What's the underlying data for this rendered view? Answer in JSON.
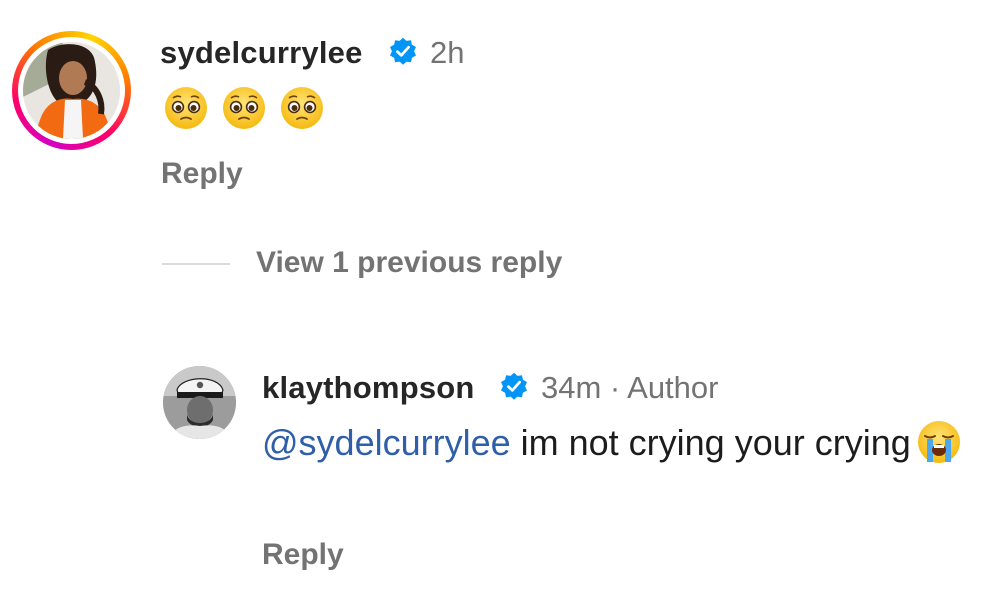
{
  "comments": [
    {
      "username": "sydelcurrylee",
      "verified": true,
      "time": "2h",
      "emojis": [
        "pleading-face",
        "pleading-face",
        "pleading-face"
      ],
      "reply_label": "Reply"
    }
  ],
  "replies_toggle": {
    "label": "View 1 previous reply"
  },
  "reply": {
    "username": "klaythompson",
    "verified": true,
    "meta": "34m · Author",
    "mention": "@sydelcurrylee",
    "text": " im not crying your crying",
    "emoji": "loudly-crying-face",
    "reply_label": "Reply"
  },
  "colors": {
    "username": "#262626",
    "secondary_text": "#737373",
    "mention_link": "#2f5fa8",
    "verified_badge": "#0095f6",
    "story_ring": [
      "#d300c5",
      "#ff0069",
      "#ff7a00",
      "#ffd600"
    ]
  }
}
